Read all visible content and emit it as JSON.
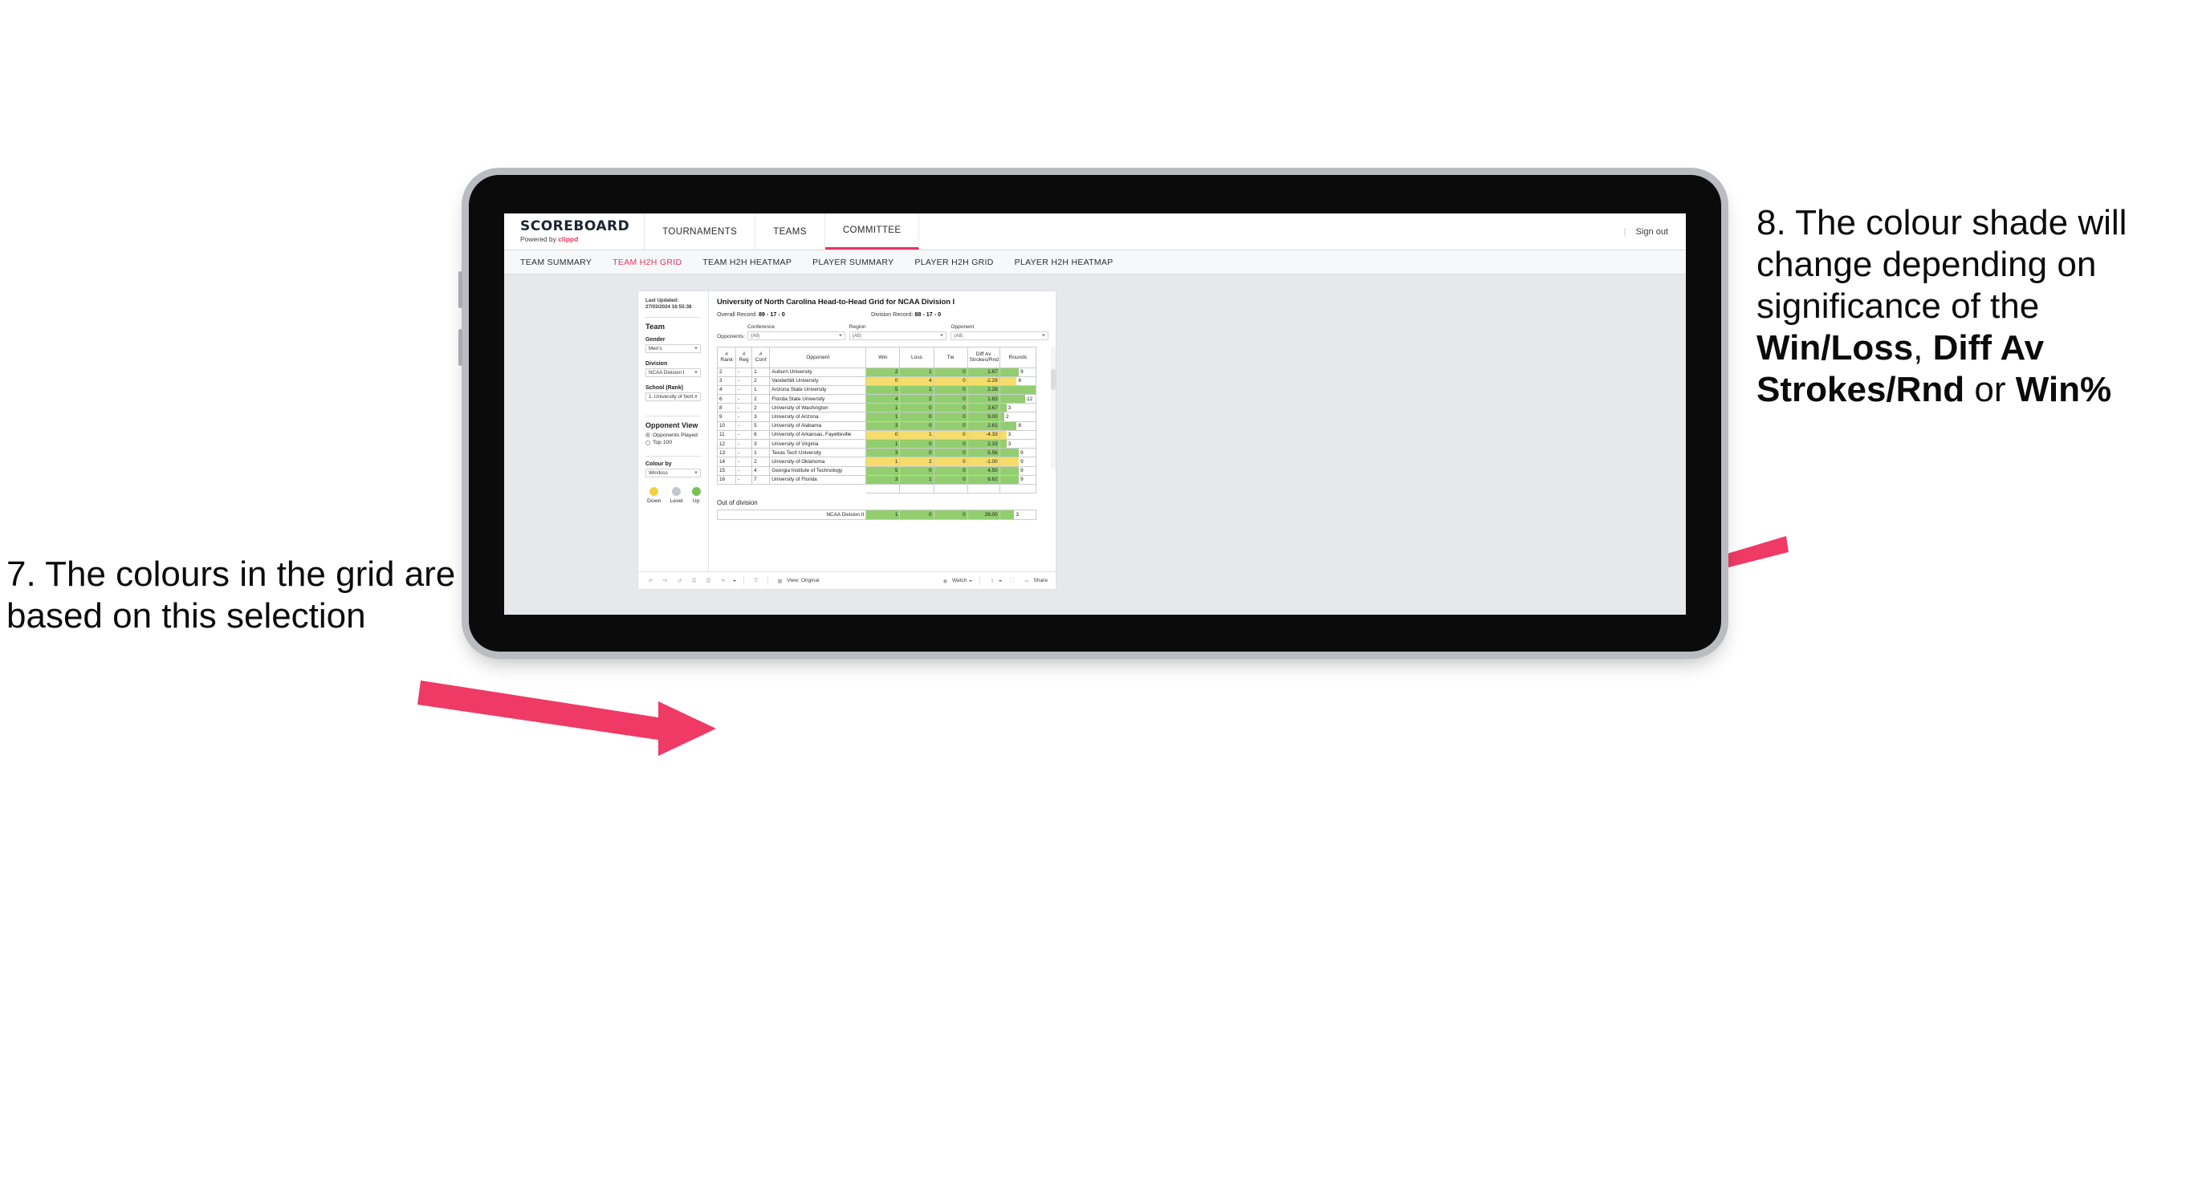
{
  "annotations": {
    "left": {
      "id": "7.",
      "text": "7. The colours in the grid are based on this selection"
    },
    "right": {
      "id": "8.",
      "lead": "8. The colour shade will change depending on significance of the ",
      "bold1": "Win/Loss",
      "mid1": ", ",
      "bold2": "Diff Av Strokes/Rnd",
      "mid2": " or ",
      "bold3": "Win%",
      "accent": "#ef3a66"
    }
  },
  "app": {
    "logo": {
      "main": "SCOREBOARD",
      "sub_prefix": "Powered by ",
      "sub_brand": "clippd"
    },
    "nav_tabs": [
      {
        "label": "TOURNAMENTS",
        "active": false
      },
      {
        "label": "TEAMS",
        "active": false
      },
      {
        "label": "COMMITTEE",
        "active": true
      }
    ],
    "header_right": {
      "separator": "|",
      "sign_out": "Sign out"
    },
    "subnav": [
      {
        "label": "TEAM SUMMARY",
        "active": false
      },
      {
        "label": "TEAM H2H GRID",
        "active": true
      },
      {
        "label": "TEAM H2H HEATMAP",
        "active": false
      },
      {
        "label": "PLAYER SUMMARY",
        "active": false
      },
      {
        "label": "PLAYER H2H GRID",
        "active": false
      },
      {
        "label": "PLAYER H2H HEATMAP",
        "active": false
      }
    ],
    "accent_color": "#e8345c"
  },
  "sidebar": {
    "last_updated": "Last Updated: 27/03/2024 16:55:38",
    "team_heading": "Team",
    "gender": {
      "label": "Gender",
      "value": "Men's"
    },
    "division": {
      "label": "Division",
      "value": "NCAA Division I"
    },
    "school": {
      "label": "School (Rank)",
      "value": "1. University of Nort..."
    },
    "opponent_view": {
      "heading": "Opponent View",
      "options": [
        {
          "label": "Opponents Played",
          "selected": true
        },
        {
          "label": "Top 100",
          "selected": false
        }
      ]
    },
    "colour_by": {
      "label": "Colour by",
      "value": "Win/loss"
    },
    "legend": [
      {
        "label": "Down",
        "color": "#f2d13f"
      },
      {
        "label": "Level",
        "color": "#c3c6ca"
      },
      {
        "label": "Up",
        "color": "#79c257"
      }
    ]
  },
  "main": {
    "title": "University of North Carolina Head-to-Head Grid for NCAA Division I",
    "overall_record_label": "Overall Record: ",
    "overall_record_value": "89 - 17 - 0",
    "division_record_label": "Division Record: ",
    "division_record_value": "88 - 17 - 0",
    "opponents_label": "Opponents:",
    "filters": [
      {
        "name": "Conference",
        "value": "(All)"
      },
      {
        "name": "Region",
        "value": "(All)"
      },
      {
        "name": "Opponent",
        "value": "(All)"
      }
    ],
    "table_headers": {
      "rank": "# Rank",
      "reg": "# Reg",
      "conf": "# Conf",
      "opponent": "Opponent",
      "win": "Win",
      "loss": "Loss",
      "tie": "Tie",
      "diff": "Diff Av Strokes/Rnd",
      "rounds": "Rounds"
    },
    "out_of_division_title": "Out of division",
    "out_of_division_row": {
      "name": "NCAA Division II",
      "win": "1",
      "loss": "0",
      "tie": "0",
      "diff": "26.00",
      "rounds": "3"
    }
  },
  "chart_data": {
    "type": "table",
    "title": "University of North Carolina Head-to-Head Grid for NCAA Division I",
    "columns": [
      "# Rank",
      "# Reg",
      "# Conf",
      "Opponent",
      "Win",
      "Loss",
      "Tie",
      "Diff Av Strokes/Rnd",
      "Rounds"
    ],
    "rounds_max": 17,
    "colors": {
      "up": "#92ce6f",
      "down": "#f6dc6a",
      "level": "#c3c6ca"
    },
    "rows": [
      {
        "rank": "2",
        "reg": "-",
        "conf": "1",
        "opponent": "Auburn University",
        "win": "2",
        "loss": "1",
        "tie": "0",
        "diff": "1.67",
        "rounds": "9",
        "state": "up"
      },
      {
        "rank": "3",
        "reg": "-",
        "conf": "2",
        "opponent": "Vanderbilt University",
        "win": "0",
        "loss": "4",
        "tie": "0",
        "diff": "-2.29",
        "rounds": "8",
        "state": "down"
      },
      {
        "rank": "4",
        "reg": "-",
        "conf": "1",
        "opponent": "Arizona State University",
        "win": "5",
        "loss": "1",
        "tie": "0",
        "diff": "2.28",
        "rounds": "17",
        "state": "up"
      },
      {
        "rank": "6",
        "reg": "-",
        "conf": "2",
        "opponent": "Florida State University",
        "win": "4",
        "loss": "2",
        "tie": "0",
        "diff": "1.83",
        "rounds": "12",
        "state": "up"
      },
      {
        "rank": "8",
        "reg": "-",
        "conf": "2",
        "opponent": "University of Washington",
        "win": "1",
        "loss": "0",
        "tie": "0",
        "diff": "3.67",
        "rounds": "3",
        "state": "up"
      },
      {
        "rank": "9",
        "reg": "-",
        "conf": "3",
        "opponent": "University of Arizona",
        "win": "1",
        "loss": "0",
        "tie": "0",
        "diff": "9.00",
        "rounds": "2",
        "state": "up"
      },
      {
        "rank": "10",
        "reg": "-",
        "conf": "5",
        "opponent": "University of Alabama",
        "win": "3",
        "loss": "0",
        "tie": "0",
        "diff": "2.61",
        "rounds": "8",
        "state": "up"
      },
      {
        "rank": "11",
        "reg": "-",
        "conf": "6",
        "opponent": "University of Arkansas, Fayetteville",
        "win": "0",
        "loss": "1",
        "tie": "0",
        "diff": "-4.33",
        "rounds": "3",
        "state": "down"
      },
      {
        "rank": "12",
        "reg": "-",
        "conf": "3",
        "opponent": "University of Virginia",
        "win": "1",
        "loss": "0",
        "tie": "0",
        "diff": "2.33",
        "rounds": "3",
        "state": "up"
      },
      {
        "rank": "13",
        "reg": "-",
        "conf": "1",
        "opponent": "Texas Tech University",
        "win": "3",
        "loss": "0",
        "tie": "0",
        "diff": "5.56",
        "rounds": "9",
        "state": "up"
      },
      {
        "rank": "14",
        "reg": "-",
        "conf": "2",
        "opponent": "University of Oklahoma",
        "win": "1",
        "loss": "2",
        "tie": "0",
        "diff": "-1.00",
        "rounds": "9",
        "state": "down"
      },
      {
        "rank": "15",
        "reg": "-",
        "conf": "4",
        "opponent": "Georgia Institute of Technology",
        "win": "5",
        "loss": "0",
        "tie": "0",
        "diff": "4.50",
        "rounds": "9",
        "state": "up"
      },
      {
        "rank": "16",
        "reg": "-",
        "conf": "7",
        "opponent": "University of Florida",
        "win": "3",
        "loss": "1",
        "tie": "0",
        "diff": "6.62",
        "rounds": "9",
        "state": "up"
      }
    ]
  },
  "toolbar": {
    "view_label": "View: Original",
    "watch_label": "Watch",
    "share_label": "Share"
  }
}
